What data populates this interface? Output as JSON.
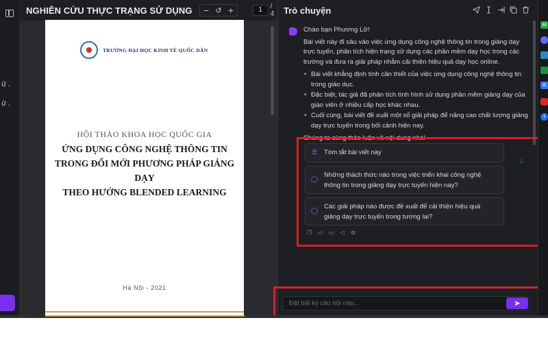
{
  "left_strip": {
    "fragments": [
      "ử .",
      "ử ."
    ]
  },
  "pdf_viewer": {
    "title": "NGHIÊN CỨU THỰC TRẠNG SỬ DỤNG CÔNG ...",
    "zoom_out_icon": "−",
    "reset_icon": "↺",
    "zoom_in_icon": "+",
    "current_page": "1",
    "total_pages": "/ 4",
    "document": {
      "university": "TRƯỜNG ĐẠI HỌC KINH TẾ QUỐC DÂN",
      "conference": "HỘI THẢO KHOA HỌC QUỐC GIA",
      "title_lines": [
        "ỨNG DỤNG CÔNG NGHỆ THÔNG TIN",
        "TRONG ĐỔI MỚI PHƯƠNG PHÁP GIẢNG DẠY",
        "THEO HƯỚNG BLENDED LEARNING"
      ],
      "place_year": "Hà Nội - 2021"
    }
  },
  "chat": {
    "header_title": "Trò chuyện",
    "header_icons": [
      "send-icon",
      "text-cursor-icon",
      "export-icon",
      "copy-icon",
      "trash-icon"
    ],
    "greeting": "Chào bạn Phương Lữ!",
    "intro": "Bài viết này đi sâu vào việc ứng dụng công nghệ thông tin trong giảng dạy trực tuyến, phân tích hiện trạng sử dụng các phần mềm dạy học trong các trường và đưa ra giải pháp nhằm cải thiện hiệu quả dạy học online.",
    "bullets": [
      "Bài viết khẳng định tính cần thiết của việc ứng dụng công nghệ thông tin trong giáo dục.",
      "Đặc biệt, tác giả đã phân tích tình hình sử dụng phần mềm giảng dạy của giáo viên ở nhiều cấp học khác nhau.",
      "Cuối cùng, bài viết đề xuất một số giải pháp để nâng cao chất lượng giảng dạy trực tuyến trong bối cảnh hiện nay."
    ],
    "closing": "Chúng ta cùng thảo luận về nội dung nhé!",
    "suggestions": [
      "Tóm tắt bài viết này",
      "Những thách thức nào trong việc triển khai công nghệ thông tin trong giảng dạy trực tuyến hiện nay?",
      "Các giải pháp nào được đề xuất để cải thiện hiệu quả giảng dạy trực tuyến trong tương lai?"
    ],
    "input_placeholder": "Đặt bất kỳ câu hỏi nào...",
    "send_icon": "➤"
  },
  "extensions": [
    "AI",
    "",
    "",
    "",
    "G",
    "",
    "f"
  ],
  "colors": {
    "accent": "#7a2ff0",
    "highlight_box": "#d81f2a",
    "background": "#1e1f22"
  }
}
